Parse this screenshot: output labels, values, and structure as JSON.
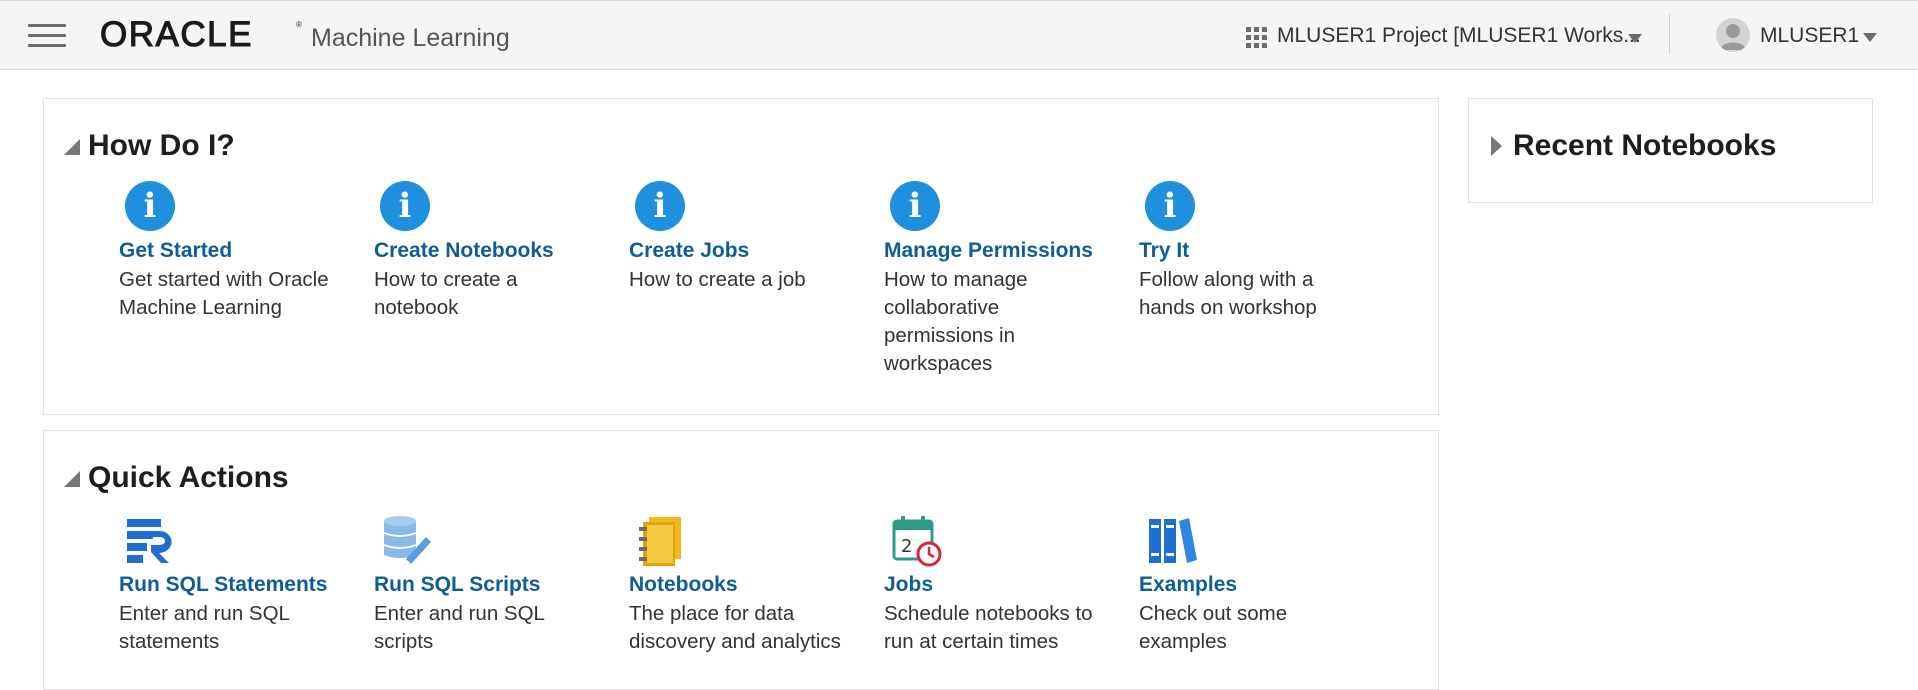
{
  "header": {
    "brand": "ORACLE",
    "app_name": "Machine Learning",
    "project_label": "MLUSER1 Project [MLUSER1 Works...",
    "user_name": "MLUSER1"
  },
  "how_do_i": {
    "title": "How Do I?",
    "cards": [
      {
        "title": "Get Started",
        "description": "Get started with Oracle Machine Learning",
        "icon": "info-icon"
      },
      {
        "title": "Create Notebooks",
        "description": "How to create a notebook",
        "icon": "info-icon"
      },
      {
        "title": "Create Jobs",
        "description": "How to create a job",
        "icon": "info-icon"
      },
      {
        "title": "Manage Permissions",
        "description": "How to manage collaborative permissions in workspaces",
        "icon": "info-icon"
      },
      {
        "title": "Try It",
        "description": "Follow along with a hands on workshop",
        "icon": "info-icon"
      }
    ]
  },
  "quick_actions": {
    "title": "Quick Actions",
    "cards": [
      {
        "title": "Run SQL Statements",
        "description": "Enter and run SQL statements",
        "icon": "sql-statements-icon"
      },
      {
        "title": "Run SQL Scripts",
        "description": "Enter and run SQL scripts",
        "icon": "sql-scripts-icon"
      },
      {
        "title": "Notebooks",
        "description": "The place for data discovery and analytics",
        "icon": "notebooks-icon"
      },
      {
        "title": "Jobs",
        "description": "Schedule notebooks to run at certain times",
        "icon": "jobs-calendar-icon"
      },
      {
        "title": "Examples",
        "description": "Check out some examples",
        "icon": "examples-books-icon"
      }
    ]
  },
  "recent_notebooks": {
    "title": "Recent Notebooks"
  },
  "colors": {
    "link_blue": "#0f5d97",
    "info_blue": "#1e90dd",
    "header_bg": "#f5f5f5",
    "panel_border": "#e1e1e1"
  }
}
